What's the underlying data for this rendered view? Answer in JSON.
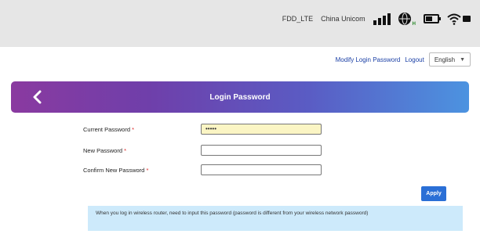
{
  "status": {
    "network_name": "FDD_LTE",
    "carrier": "China Unicom",
    "signal_bars": 4,
    "internet_icon": "globe-icon",
    "internet_tag": "H",
    "battery_level": 0.6,
    "wifi_icon": "wifi-icon"
  },
  "account": {
    "modify_password": "Modify Login Password",
    "logout": "Logout",
    "language": "English"
  },
  "page": {
    "title": "Login Password",
    "back_icon": "back-chevron-icon"
  },
  "form": {
    "current_password_label": "Current Password",
    "current_password_value": "•••••",
    "new_password_label": "New Password",
    "confirm_password_label": "Confirm New Password",
    "required_mark": "*"
  },
  "apply_label": "Apply",
  "notice": "When you log in wireless router, need to input this password (password is different from your wireless network password)",
  "colors": {
    "banner_start": "#8a3aa0",
    "banner_end": "#4c93e0",
    "apply": "#2a6fd6",
    "notice_bg": "#cdeafb",
    "filled_input": "#fbf5c4"
  }
}
